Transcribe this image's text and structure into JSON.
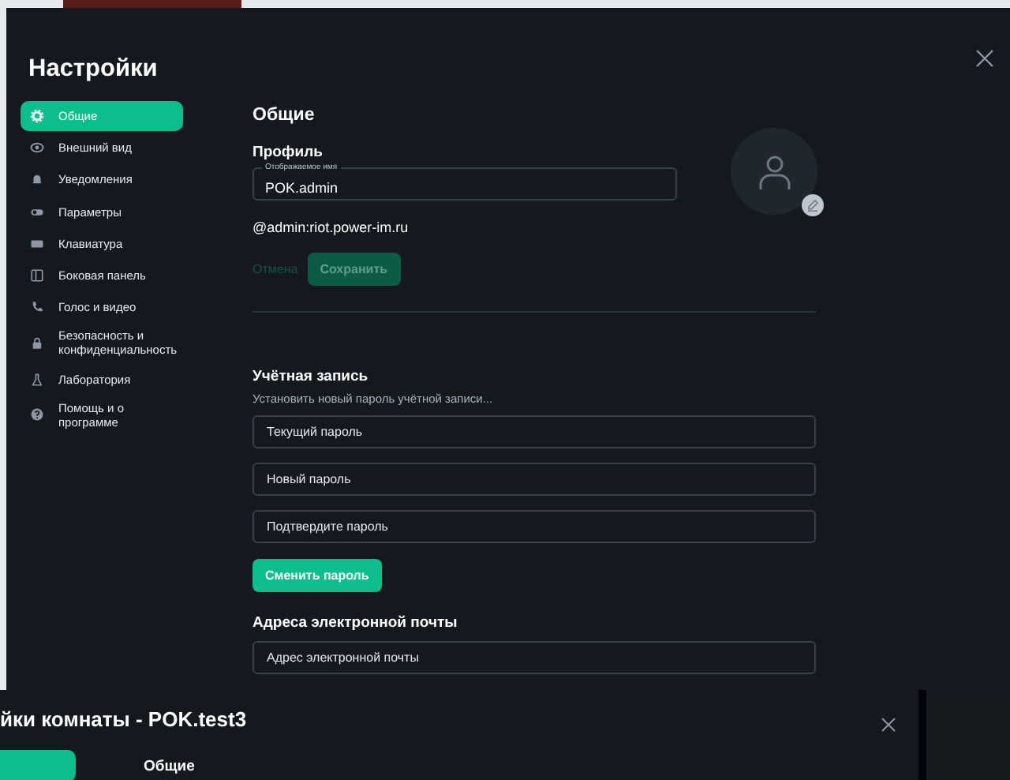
{
  "settings_dialog": {
    "title": "Настройки",
    "sidebar": {
      "items": [
        {
          "label": "Общие",
          "selected": true
        },
        {
          "label": "Внешний вид",
          "selected": false
        },
        {
          "label": "Уведомления",
          "selected": false
        },
        {
          "label": "Параметры",
          "selected": false
        },
        {
          "label": "Клавиатура",
          "selected": false
        },
        {
          "label": "Боковая панель",
          "selected": false
        },
        {
          "label": "Голос и видео",
          "selected": false
        },
        {
          "label": "Безопасность и конфиденциальность",
          "selected": false
        },
        {
          "label": "Лаборатория",
          "selected": false
        },
        {
          "label": "Помощь и о программе",
          "selected": false
        }
      ]
    },
    "heading": "Общие",
    "profile": {
      "heading": "Профиль",
      "display_name": {
        "label": "Отображаемое имя",
        "value": "POK.admin"
      },
      "user_id": "@admin:riot.power-im.ru",
      "buttons": [
        {
          "label": "Отмена",
          "kind": "link",
          "disabled": true
        },
        {
          "label": "Сохранить",
          "kind": "primary",
          "disabled": true
        }
      ]
    },
    "account": {
      "heading": "Учётная запись",
      "description": "Установить новый пароль учётной записи...",
      "fields": [
        {
          "placeholder": "Текущий пароль"
        },
        {
          "placeholder": "Новый пароль"
        },
        {
          "placeholder": "Подтвердите пароль"
        }
      ],
      "button": {
        "label": "Сменить пароль",
        "disabled": false
      }
    },
    "email": {
      "heading": "Адреса электронной почты",
      "field": {
        "placeholder": "Адрес электронной почты"
      }
    }
  },
  "room_settings_dialog": {
    "title": "йки комнаты - POK.test3",
    "tabs": [
      {
        "selected": true
      }
    ],
    "heading": "Общие"
  }
}
